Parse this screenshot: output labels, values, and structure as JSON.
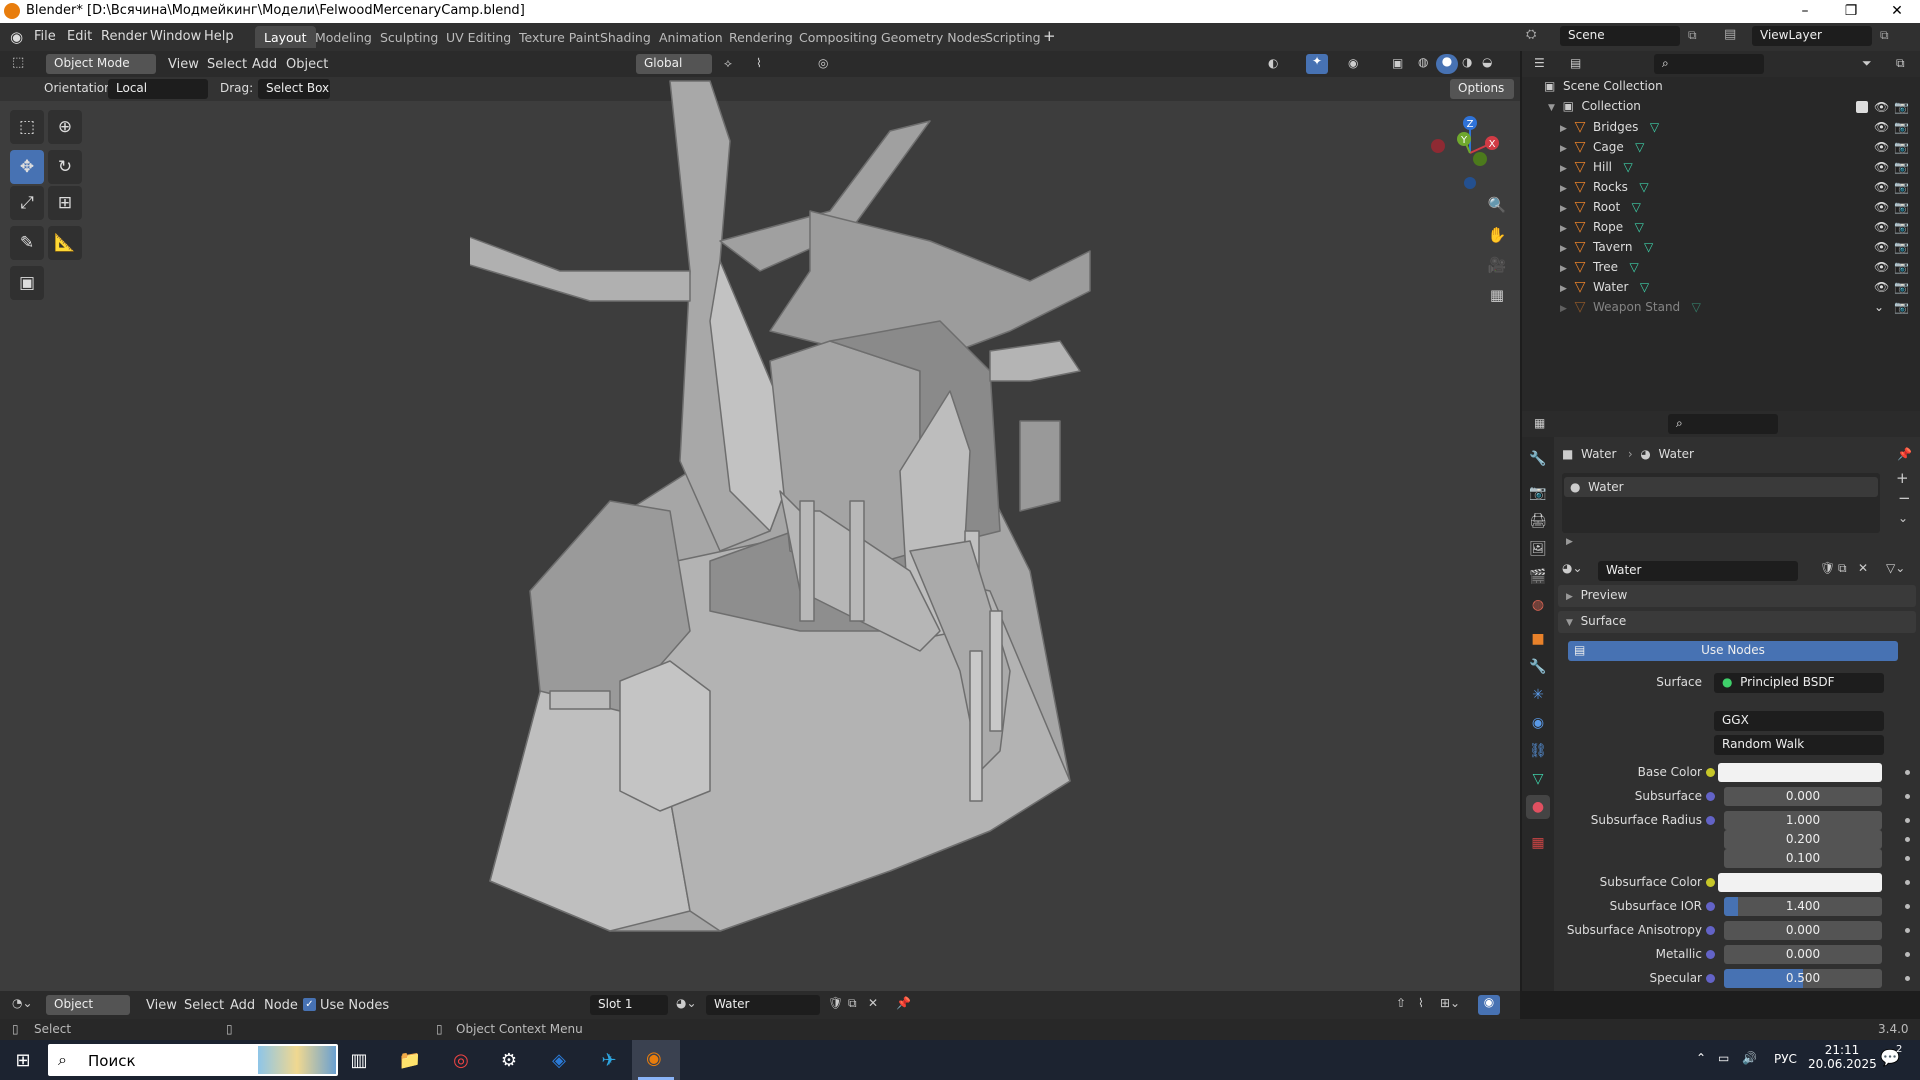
{
  "window": {
    "title": "Blender* [D:\\Всячина\\Модмейкинг\\Модели\\FelwoodMercenaryCamp.blend]",
    "minimize": "–",
    "maximize": "❐",
    "close": "✕"
  },
  "menu": [
    "File",
    "Edit",
    "Render",
    "Window",
    "Help"
  ],
  "workspaces": [
    "Layout",
    "Modeling",
    "Sculpting",
    "UV Editing",
    "Texture Paint",
    "Shading",
    "Animation",
    "Rendering",
    "Compositing",
    "Geometry Nodes",
    "Scripting"
  ],
  "add_workspace": "+",
  "scene": {
    "name": "Scene",
    "view_layer": "ViewLayer"
  },
  "viewport": {
    "mode": "Object Mode",
    "menus": [
      "View",
      "Select",
      "Add",
      "Object"
    ],
    "transform_orientation": "Global",
    "orientation_label": "Orientation:",
    "orientation_value": "Local",
    "drag_label": "Drag:",
    "drag_value": "Select Box",
    "options_label": "Options",
    "gizmo": {
      "x": "X",
      "y": "Y",
      "z": "Z"
    }
  },
  "outliner": {
    "root": "Scene Collection",
    "collection": "Collection",
    "objects": [
      "Bridges",
      "Cage",
      "Hill",
      "Rocks",
      "Root",
      "Rope",
      "Tavern",
      "Tree",
      "Water",
      "Weapon Stand"
    ]
  },
  "properties": {
    "breadcrumb_object": "Water",
    "breadcrumb_material": "Water",
    "slot_material": "Water",
    "material_name": "Water",
    "preview_label": "Preview",
    "surface_section": "Surface",
    "use_nodes": "Use Nodes",
    "surface_label": "Surface",
    "surface_value": "Principled BSDF",
    "distribution": "GGX",
    "subsurface_method": "Random Walk",
    "params": [
      {
        "label": "Base Color",
        "value": "",
        "kind": "color"
      },
      {
        "label": "Subsurface",
        "value": "0.000",
        "kind": "num"
      },
      {
        "label": "Subsurface Radius",
        "value": "1.000",
        "kind": "num"
      },
      {
        "label": "",
        "value": "0.200",
        "kind": "num"
      },
      {
        "label": "",
        "value": "0.100",
        "kind": "num"
      },
      {
        "label": "Subsurface Color",
        "value": "",
        "kind": "color"
      },
      {
        "label": "Subsurface IOR",
        "value": "1.400",
        "kind": "num",
        "fill": 0.09
      },
      {
        "label": "Subsurface Anisotropy",
        "value": "0.000",
        "kind": "num"
      },
      {
        "label": "Metallic",
        "value": "0.000",
        "kind": "num"
      },
      {
        "label": "Specular",
        "value": "0.500",
        "kind": "num",
        "fill": 0.5
      }
    ]
  },
  "node_editor": {
    "type": "Object",
    "menus": [
      "View",
      "Select",
      "Add",
      "Node"
    ],
    "use_nodes": "Use Nodes",
    "slot": "Slot 1",
    "material": "Water"
  },
  "status": {
    "left": "Select",
    "middle": "Object Context Menu",
    "version": "3.4.0"
  },
  "taskbar": {
    "search": "Поиск",
    "lang": "РУС",
    "time": "21:11",
    "date": "20.06.2025",
    "notifications": "2"
  },
  "colors": {
    "accent": "#4772b3",
    "object": "#e8812a",
    "mesh": "#3fd0a8"
  }
}
